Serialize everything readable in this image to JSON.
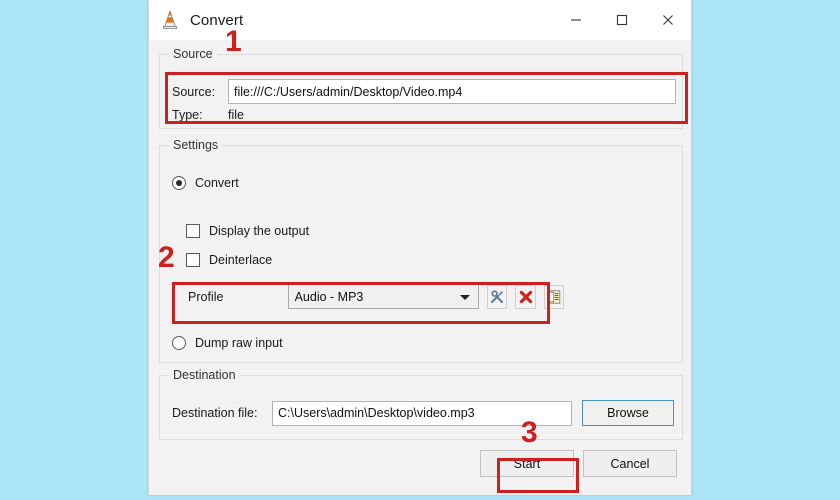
{
  "window": {
    "title": "Convert",
    "app_icon": "vlc-cone-icon",
    "controls": {
      "minimize": "—",
      "maximize": "□",
      "close": "✕"
    }
  },
  "source_group": {
    "legend": "Source",
    "source_label": "Source:",
    "source_value": "file:///C:/Users/admin/Desktop/Video.mp4",
    "type_label": "Type:",
    "type_value": "file"
  },
  "settings_group": {
    "legend": "Settings",
    "convert_label": "Convert",
    "convert_selected": true,
    "display_output_label": "Display the output",
    "display_output_checked": false,
    "deinterlace_label": "Deinterlace",
    "deinterlace_checked": false,
    "profile_label": "Profile",
    "profile_value": "Audio - MP3",
    "profile_buttons": [
      {
        "name": "edit-profile-icon",
        "title": "Edit selected profile"
      },
      {
        "name": "delete-profile-icon",
        "title": "Delete selected profile"
      },
      {
        "name": "new-profile-icon",
        "title": "Create a new profile"
      }
    ],
    "dump_raw_label": "Dump raw input",
    "dump_raw_selected": false
  },
  "destination_group": {
    "legend": "Destination",
    "dest_file_label": "Destination file:",
    "dest_file_value": "C:\\Users\\admin\\Desktop\\video.mp3",
    "browse_label": "Browse"
  },
  "buttons": {
    "start_label": "Start",
    "cancel_label": "Cancel"
  },
  "annotations": {
    "step1": "1",
    "step2": "2",
    "step3": "3",
    "highlight_color": "#cc1f1f"
  },
  "colors": {
    "desktop_background": "#ace5f8",
    "dialog_background": "#f2f2f2",
    "titlebar_background": "#ffffff",
    "annotation_red": "#cc1f1f",
    "focus_blue": "#4a90c4"
  }
}
